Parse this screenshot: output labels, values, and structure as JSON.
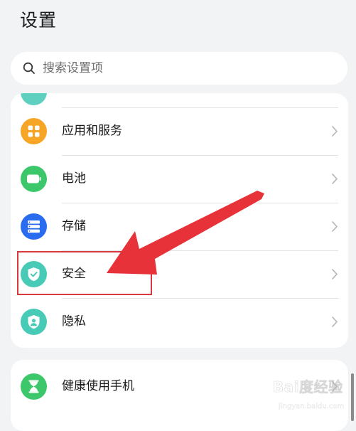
{
  "page": {
    "title": "设置"
  },
  "search": {
    "placeholder": "搜索设置项"
  },
  "group1": {
    "items": [
      {
        "label": "应用和服务",
        "icon": "apps-icon",
        "color": "#f6a524"
      },
      {
        "label": "电池",
        "icon": "battery-icon",
        "color": "#3cc76a"
      },
      {
        "label": "存储",
        "icon": "storage-icon",
        "color": "#2a6cf0"
      },
      {
        "label": "安全",
        "icon": "shield-check-icon",
        "color": "#47cbb6"
      },
      {
        "label": "隐私",
        "icon": "privacy-icon",
        "color": "#47cbb6"
      }
    ]
  },
  "group2": {
    "items": [
      {
        "label": "健康使用手机",
        "icon": "hourglass-icon",
        "color": "#3cc76a"
      }
    ]
  },
  "annotation": {
    "color": "#e8323a"
  },
  "watermark": {
    "main": "Bai度经验",
    "sub": "jingyan.baidu.com"
  }
}
